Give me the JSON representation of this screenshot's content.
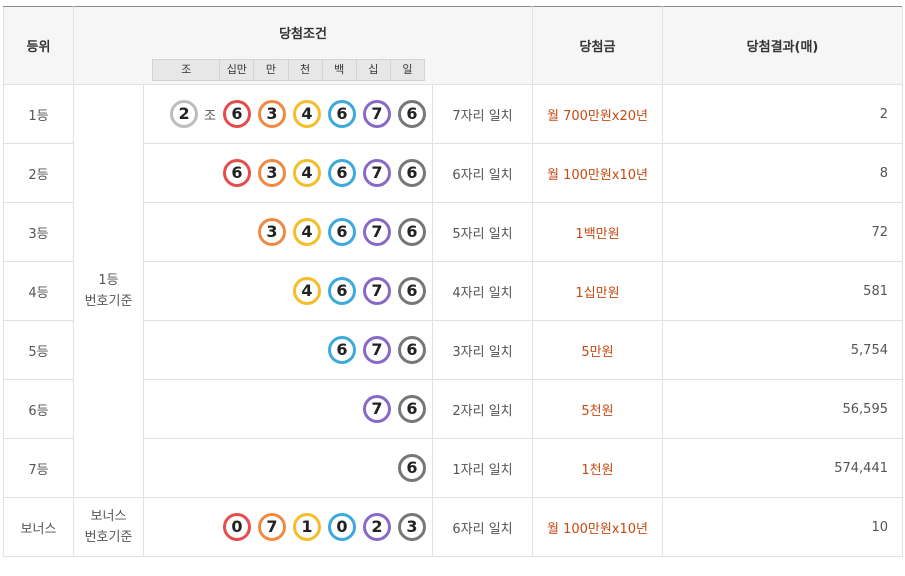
{
  "header": {
    "rank": "등위",
    "condition": "당첨조건",
    "prize": "당첨금",
    "result": "당첨결과(매)",
    "digit_labels": [
      "조",
      "십만",
      "만",
      "천",
      "백",
      "십",
      "일"
    ]
  },
  "basis": {
    "first": [
      "1등",
      "번호기준"
    ],
    "bonus": [
      "보너스",
      "번호기준"
    ]
  },
  "jo_text": "조",
  "ball_colors": {
    "2": "#bdbdbd",
    "6": "#e64c4c",
    "3": "#f08a43",
    "4": "#f5bd28",
    "6b": "#3da9dd",
    "7": "#8a68c7",
    "6g": "#777777",
    "0": "#e64c4c",
    "7o": "#f08a43",
    "1": "#f5bd28",
    "0b": "#3da9dd",
    "2p": "#8a68c7",
    "3g": "#777777"
  },
  "rows": [
    {
      "rank": "1등",
      "jo": "2",
      "balls": [
        {
          "n": "6",
          "color": "#e64c4c"
        },
        {
          "n": "3",
          "color": "#f08a43"
        },
        {
          "n": "4",
          "color": "#f5bd28"
        },
        {
          "n": "6",
          "color": "#3da9dd"
        },
        {
          "n": "7",
          "color": "#8a68c7"
        },
        {
          "n": "6",
          "color": "#777777"
        }
      ],
      "match": "7자리 일치",
      "prize": "월 700만원x20년",
      "result": "2"
    },
    {
      "rank": "2등",
      "balls": [
        {
          "n": "6",
          "color": "#e64c4c"
        },
        {
          "n": "3",
          "color": "#f08a43"
        },
        {
          "n": "4",
          "color": "#f5bd28"
        },
        {
          "n": "6",
          "color": "#3da9dd"
        },
        {
          "n": "7",
          "color": "#8a68c7"
        },
        {
          "n": "6",
          "color": "#777777"
        }
      ],
      "match": "6자리 일치",
      "prize": "월 100만원x10년",
      "result": "8"
    },
    {
      "rank": "3등",
      "balls": [
        {
          "n": "3",
          "color": "#f08a43"
        },
        {
          "n": "4",
          "color": "#f5bd28"
        },
        {
          "n": "6",
          "color": "#3da9dd"
        },
        {
          "n": "7",
          "color": "#8a68c7"
        },
        {
          "n": "6",
          "color": "#777777"
        }
      ],
      "match": "5자리 일치",
      "prize": "1백만원",
      "result": "72"
    },
    {
      "rank": "4등",
      "balls": [
        {
          "n": "4",
          "color": "#f5bd28"
        },
        {
          "n": "6",
          "color": "#3da9dd"
        },
        {
          "n": "7",
          "color": "#8a68c7"
        },
        {
          "n": "6",
          "color": "#777777"
        }
      ],
      "match": "4자리 일치",
      "prize": "1십만원",
      "result": "581"
    },
    {
      "rank": "5등",
      "balls": [
        {
          "n": "6",
          "color": "#3da9dd"
        },
        {
          "n": "7",
          "color": "#8a68c7"
        },
        {
          "n": "6",
          "color": "#777777"
        }
      ],
      "match": "3자리 일치",
      "prize": "5만원",
      "result": "5,754"
    },
    {
      "rank": "6등",
      "balls": [
        {
          "n": "7",
          "color": "#8a68c7"
        },
        {
          "n": "6",
          "color": "#777777"
        }
      ],
      "match": "2자리 일치",
      "prize": "5천원",
      "result": "56,595"
    },
    {
      "rank": "7등",
      "balls": [
        {
          "n": "6",
          "color": "#777777"
        }
      ],
      "match": "1자리 일치",
      "prize": "1천원",
      "result": "574,441"
    },
    {
      "rank": "보너스",
      "balls": [
        {
          "n": "0",
          "color": "#e64c4c"
        },
        {
          "n": "7",
          "color": "#f08a43"
        },
        {
          "n": "1",
          "color": "#f5bd28"
        },
        {
          "n": "0",
          "color": "#3da9dd"
        },
        {
          "n": "2",
          "color": "#8a68c7"
        },
        {
          "n": "3",
          "color": "#777777"
        }
      ],
      "match": "6자리 일치",
      "prize": "월 100만원x10년",
      "result": "10"
    }
  ],
  "jo_ball_color": "#bdbdbd"
}
